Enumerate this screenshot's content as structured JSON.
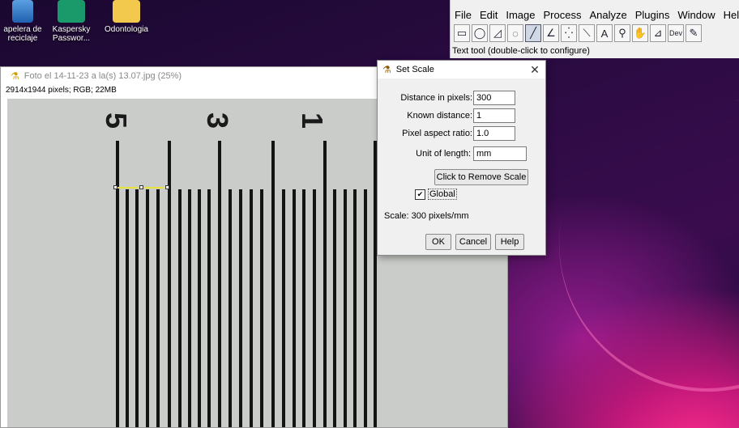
{
  "desktop": {
    "icons": [
      {
        "label": "apelera de reciclaje",
        "icon": "recycle-bin-icon"
      },
      {
        "label": "Kaspersky Passwor...",
        "icon": "kaspersky-icon"
      },
      {
        "label": "Odontologia",
        "icon": "folder-icon"
      }
    ]
  },
  "toolbar": {
    "menus": [
      "File",
      "Edit",
      "Image",
      "Process",
      "Analyze",
      "Plugins",
      "Window",
      "Hel"
    ],
    "tools": [
      "rectangle",
      "oval",
      "polygon",
      "freehand",
      "line",
      "angle",
      "point",
      "wand",
      "text",
      "zoom",
      "hand",
      "dropper",
      "dev",
      "pencil"
    ],
    "dev_label": "Dev",
    "text_tool_label": "A",
    "status": "Text tool (double-click to configure)"
  },
  "image_window": {
    "title": "Foto el 14-11-23 a la(s) 13.07.jpg (25%)",
    "info": "2914x1944 pixels; RGB; 22MB",
    "ruler_numbers": [
      "5",
      "3",
      "1"
    ]
  },
  "dialog": {
    "title": "Set Scale",
    "distance_label": "Distance in pixels:",
    "distance_value": "300",
    "known_label": "Known distance:",
    "known_value": "1",
    "aspect_label": "Pixel aspect ratio:",
    "aspect_value": "1.0",
    "unit_label": "Unit of length:",
    "unit_value": "mm",
    "remove_button": "Click to Remove Scale",
    "global_label": "Global",
    "global_checked": true,
    "scale_text": "Scale: 300 pixels/mm",
    "ok": "OK",
    "cancel": "Cancel",
    "help": "Help",
    "close_glyph": "✕"
  },
  "colors": {
    "selection_line": "#e8e040",
    "accent": "#cfd8e4"
  }
}
